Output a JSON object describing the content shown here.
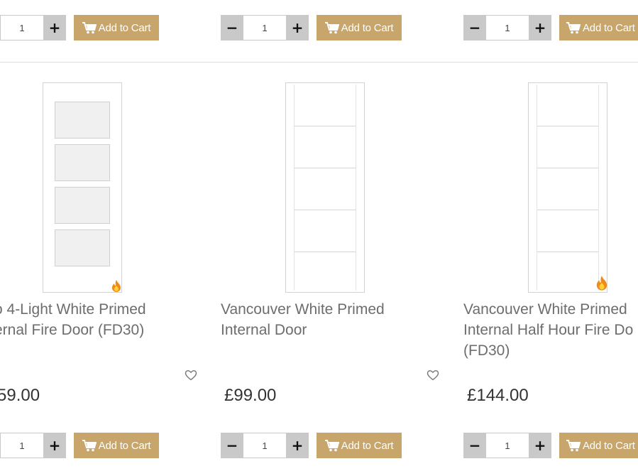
{
  "quantity_default": "1",
  "cart_label": "Add to Cart",
  "colors": {
    "cart": "#c7a56b",
    "qty_btn": "#c9c9c9",
    "title": "#6d6d6d"
  },
  "products": [
    {
      "title_line1": "o 4-Light White Primed",
      "title_line2": "ernal Fire Door (FD30)",
      "title_line3": "",
      "price": "59.00",
      "fire_rated": true
    },
    {
      "title_line1": "Vancouver White Primed",
      "title_line2": "Internal Door",
      "title_line3": "",
      "price": "£99.00",
      "fire_rated": false
    },
    {
      "title_line1": "Vancouver White Primed",
      "title_line2": "Internal Half Hour Fire Do",
      "title_line3": "(FD30)",
      "price": "£144.00",
      "fire_rated": true
    }
  ]
}
